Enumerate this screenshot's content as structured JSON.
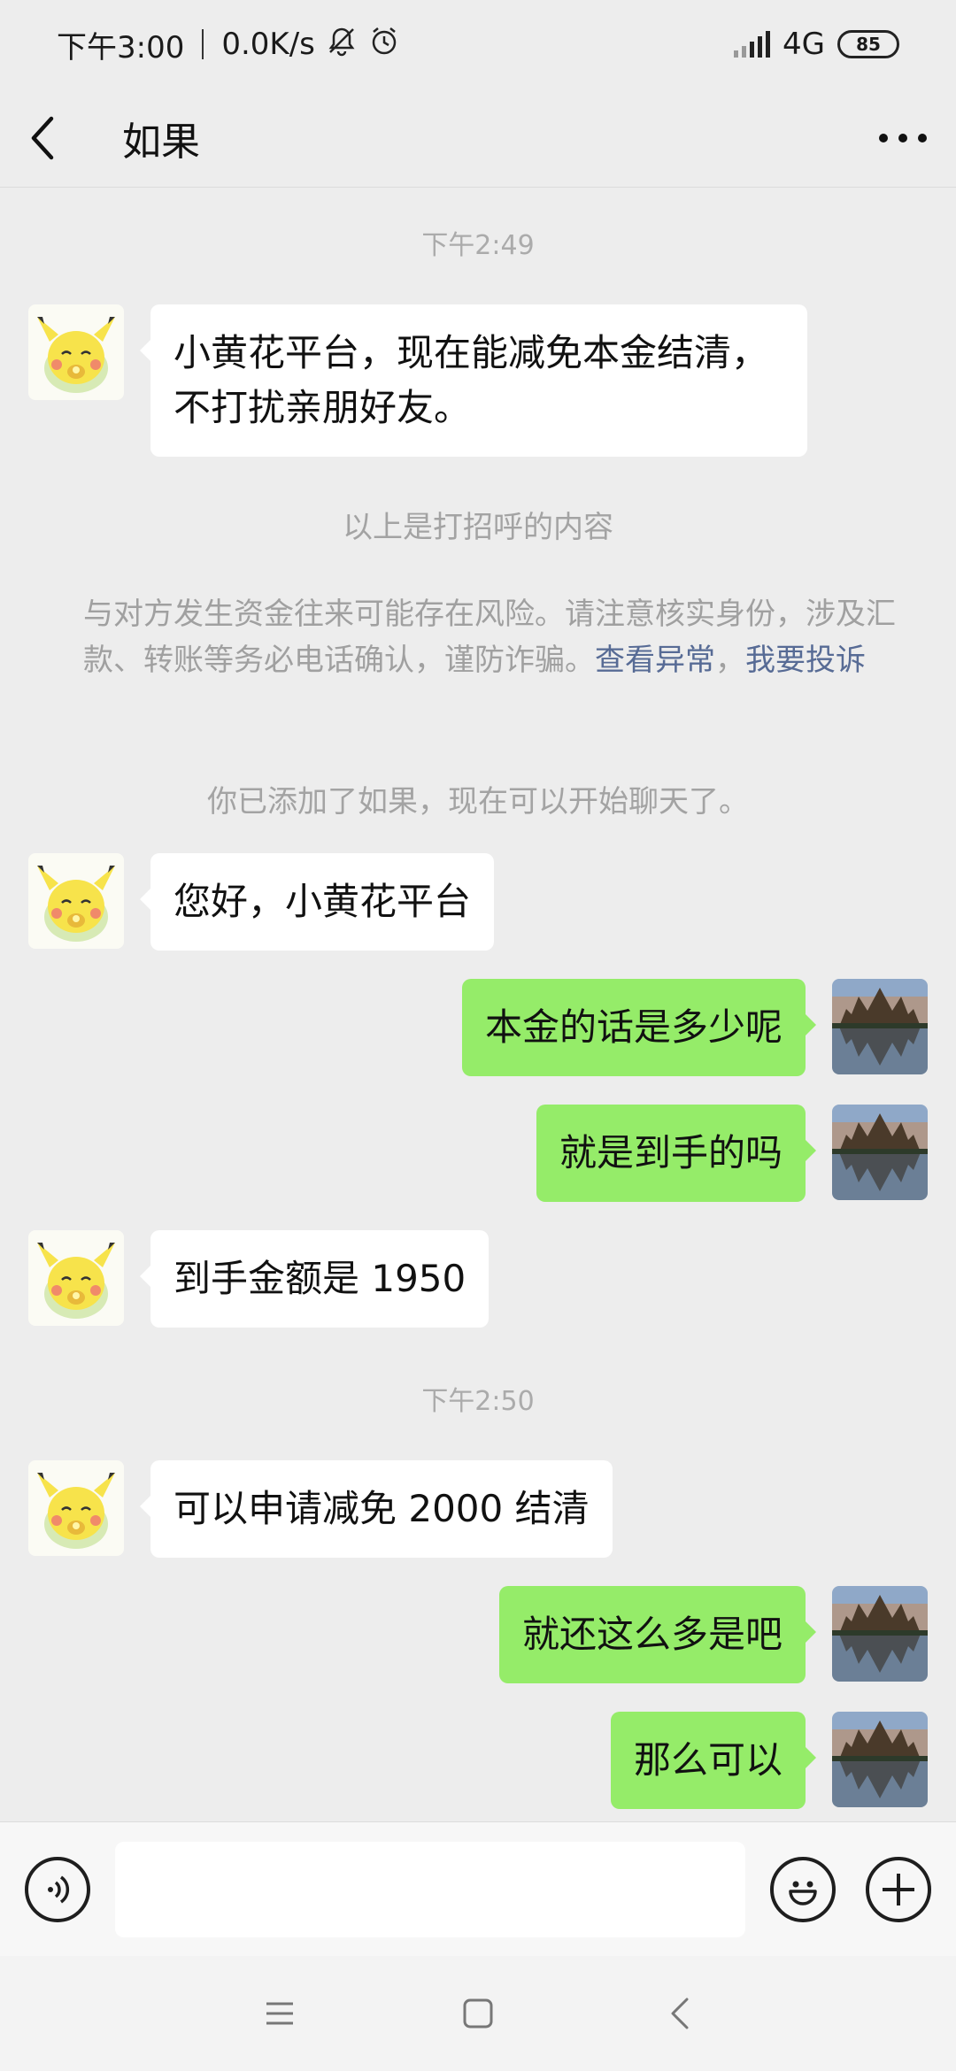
{
  "status_bar": {
    "time": "下午3:00",
    "speed": "0.0K/s",
    "network": "4G",
    "battery": "85"
  },
  "header": {
    "title": "如果"
  },
  "chat": {
    "time_1": "下午2:49",
    "msg_1": "小黄花平台，现在能减免本金结清，\n不打扰亲朋好友。",
    "system_1": "以上是打招呼的内容",
    "warning_text": "与对方发生资金往来可能存在风险。请注意核实身份，涉及汇款、转账等务必电话确认，谨防诈骗。",
    "warning_link_1": "查看异常",
    "warning_comma": "，",
    "warning_link_2": "我要投诉",
    "system_2": "你已添加了如果，现在可以开始聊天了。",
    "msg_2": "您好，小黄花平台",
    "msg_3": "本金的话是多少呢",
    "msg_4": "就是到手的吗",
    "msg_5": "到手金额是 1950",
    "time_2": "下午2:50",
    "msg_6": "可以申请减免 2000 结清",
    "msg_7": "就还这么多是吧",
    "msg_8": "那么可以"
  },
  "input": {
    "value": ""
  },
  "colors": {
    "outgoing_bubble": "#95ec69",
    "incoming_bubble": "#ffffff",
    "background": "#ededed",
    "link": "#576b95"
  },
  "icons": {
    "back": "chevron-left-icon",
    "more": "more-dots-icon",
    "voice": "voice-icon",
    "emoji": "emoji-icon",
    "plus": "plus-icon",
    "nav_menu": "menu-icon",
    "nav_home": "home-icon",
    "nav_back": "back-icon"
  }
}
